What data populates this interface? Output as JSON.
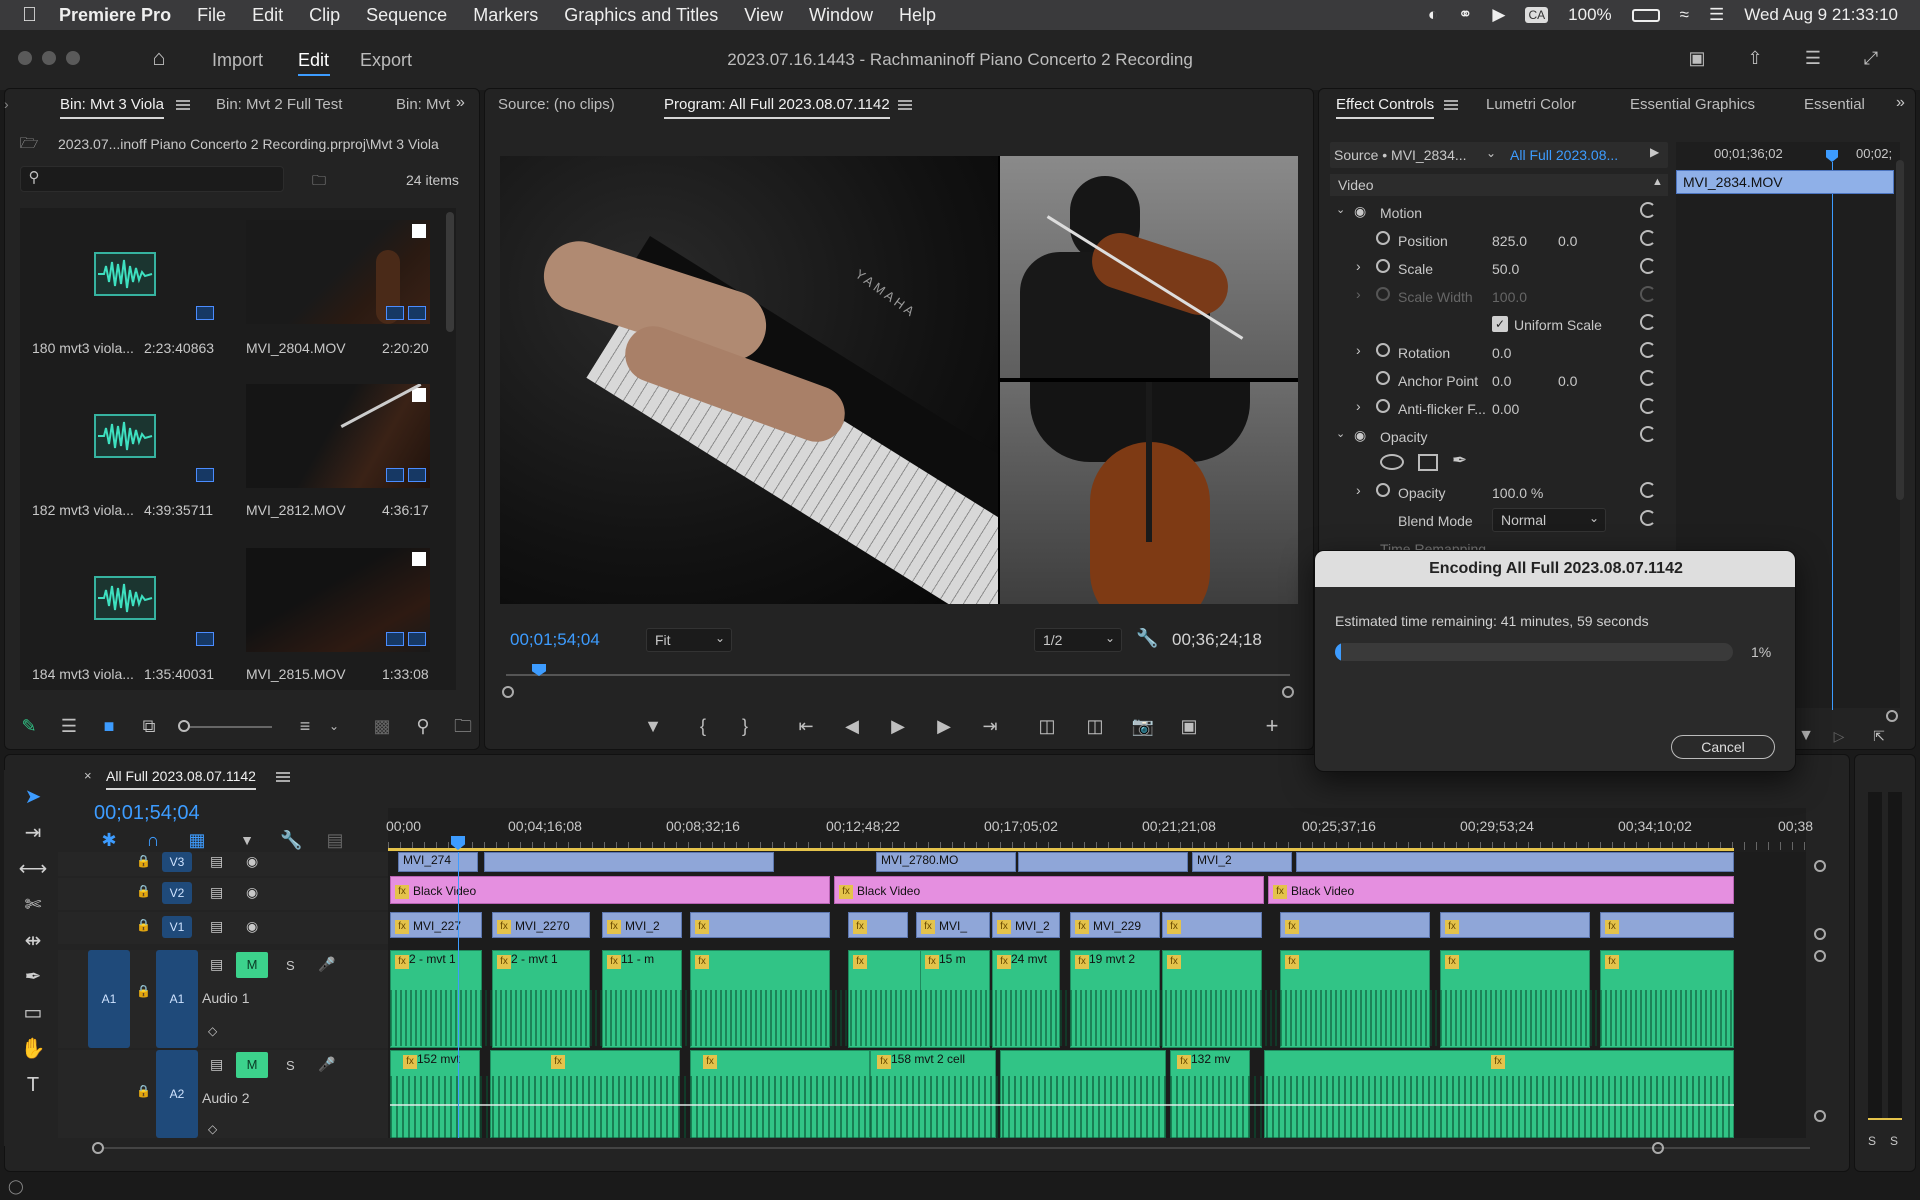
{
  "menubar": {
    "app_name": "Premiere Pro",
    "items": [
      "File",
      "Edit",
      "Clip",
      "Sequence",
      "Markers",
      "Graphics and Titles",
      "View",
      "Window",
      "Help"
    ],
    "battery": "100%",
    "clock": "Wed Aug 9  21:33:10"
  },
  "header": {
    "nav": [
      "Import",
      "Edit",
      "Export"
    ],
    "title": "2023.07.16.1443 - Rachmaninoff Piano Concerto 2 Recording"
  },
  "project": {
    "tabs": [
      "Bin: Mvt 3 Viola",
      "Bin: Mvt 2 Full Test",
      "Bin: Mvt"
    ],
    "path": "2023.07...inoff Piano Concerto 2 Recording.prproj\\Mvt 3 Viola",
    "item_count": "24 items",
    "items": [
      {
        "name": "180 mvt3 viola...",
        "duration": "2:23:40863"
      },
      {
        "name": "MVI_2804.MOV",
        "duration": "2:20:20"
      },
      {
        "name": "182 mvt3 viola...",
        "duration": "4:39:35711"
      },
      {
        "name": "MVI_2812.MOV",
        "duration": "4:36:17"
      },
      {
        "name": "184 mvt3 viola...",
        "duration": "1:35:40031"
      },
      {
        "name": "MVI_2815.MOV",
        "duration": "1:33:08"
      }
    ]
  },
  "monitor": {
    "source_tab": "Source: (no clips)",
    "program_tab": "Program: All Full 2023.08.07.1142",
    "timecode": "00;01;54;04",
    "fit": "Fit",
    "resolution": "1/2",
    "duration": "00;36;24;18",
    "piano_brand": "YAMAHA"
  },
  "effect_controls": {
    "tabs": [
      "Effect Controls",
      "Lumetri Color",
      "Essential Graphics",
      "Essential"
    ],
    "source": "Source • MVI_2834...",
    "sequence": "All Full 2023.08...",
    "mini_timecodes": [
      "00;01;36;02",
      "00;02;"
    ],
    "mini_clip": "MVI_2834.MOV",
    "section": "Video",
    "motion": "Motion",
    "position_label": "Position",
    "position_x": "825.0",
    "position_y": "0.0",
    "scale_label": "Scale",
    "scale_value": "50.0",
    "scale_width_label": "Scale Width",
    "scale_width_value": "100.0",
    "uniform_scale": "Uniform Scale",
    "rotation_label": "Rotation",
    "rotation_value": "0.0",
    "anchor_label": "Anchor Point",
    "anchor_x": "0.0",
    "anchor_y": "0.0",
    "antiflicker_label": "Anti-flicker F...",
    "antiflicker_value": "0.00",
    "opacity_group": "Opacity",
    "opacity_label": "Opacity",
    "opacity_value": "100.0 %",
    "blend_label": "Blend Mode",
    "blend_value": "Normal",
    "time_remap": "Time Remapping"
  },
  "dialog": {
    "title": "Encoding All Full 2023.08.07.1142",
    "message": "Estimated time remaining: 41 minutes, 59 seconds",
    "progress": 0.01,
    "percent": "1%",
    "cancel": "Cancel"
  },
  "timeline": {
    "sequence_tab": "All Full 2023.08.07.1142",
    "timecode": "00;01;54;04",
    "ruler": [
      "00;00",
      "00;04;16;08",
      "00;08;32;16",
      "00;12;48;22",
      "00;17;05;02",
      "00;21;21;08",
      "00;25;37;16",
      "00;29;53;24",
      "00;34;10;02",
      "00;38"
    ],
    "tracks": {
      "v3": "V3",
      "v2": "V2",
      "v1": "V1",
      "a1_src": "A1",
      "a1": "A1",
      "a2": "A2",
      "audio1": "Audio 1",
      "audio2": "Audio 2",
      "m": "M",
      "s": "S"
    },
    "v3_clips": [
      "MVI_274",
      "MVI_2780.MO",
      "MVI_2"
    ],
    "black_video": "Black Video",
    "v1_clips": [
      "MVI_227",
      "MVI_2270",
      "MVI_2",
      "MVI_",
      "MVI_2",
      "MVI_229"
    ],
    "a1_clips": [
      "2 - mvt 1",
      "2 - mvt 1",
      "11 - m",
      "15 m",
      "24 mvt",
      "19 mvt 2"
    ],
    "a2_clips": [
      "152 mvt",
      "158 mvt 2 cell",
      "132 mv"
    ],
    "meter_s": "S"
  },
  "colors": {
    "accent": "#3d9cff",
    "audio": "#31c486",
    "video": "#8fa6d8",
    "pink": "#e58fe0",
    "meter": "#e4c34b"
  }
}
